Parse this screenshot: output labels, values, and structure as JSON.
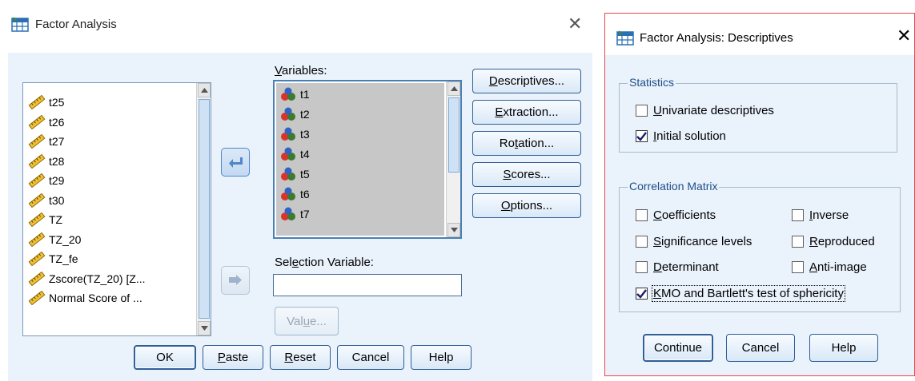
{
  "main_dialog": {
    "title": "Factor Analysis",
    "source_list": [
      "t25",
      "t26",
      "t27",
      "t28",
      "t29",
      "t30",
      "TZ",
      "TZ_20",
      "TZ_fe",
      "Zscore(TZ_20) [Z...",
      "Normal Score of ..."
    ],
    "variables_label": "Variables:",
    "variables_list": [
      "t1",
      "t2",
      "t3",
      "t4",
      "t5",
      "t6",
      "t7"
    ],
    "selection_variable_label": "Selection Variable:",
    "selection_variable_value": "",
    "value_button": "Value...",
    "side_buttons": {
      "descriptives": "Descriptives...",
      "extraction": "Extraction...",
      "rotation": "Rotation...",
      "scores": "Scores...",
      "options": "Options..."
    },
    "bottom_buttons": {
      "ok": "OK",
      "paste": "Paste",
      "reset": "Reset",
      "cancel": "Cancel",
      "help": "Help"
    }
  },
  "descriptives_dialog": {
    "title": "Factor Analysis: Descriptives",
    "statistics_group": "Statistics",
    "univariate": {
      "label": "Univariate descriptives",
      "checked": false
    },
    "initial_solution": {
      "label": "Initial solution",
      "checked": true
    },
    "correlation_group": "Correlation Matrix",
    "coefficients": {
      "label": "Coefficients",
      "checked": false
    },
    "significance": {
      "label": "Significance levels",
      "checked": false
    },
    "determinant": {
      "label": "Determinant",
      "checked": false
    },
    "inverse": {
      "label": "Inverse",
      "checked": false
    },
    "reproduced": {
      "label": "Reproduced",
      "checked": false
    },
    "anti_image": {
      "label": "Anti-image",
      "checked": false
    },
    "kmo": {
      "label": "KMO and Bartlett's test of sphericity",
      "checked": true
    },
    "buttons": {
      "continue": "Continue",
      "cancel": "Cancel",
      "help": "Help"
    }
  },
  "icons": {
    "app_icon": "spss-table-icon",
    "scale_variable_icon": "ruler-pencil-icon",
    "nominal_variable_icon": "three-balls-icon",
    "move_left_arrow": "arrow-left-icon",
    "move_right_arrow": "arrow-right-icon",
    "close": "close-icon"
  },
  "colors": {
    "dialog_bg": "#eaf2fb",
    "button_border": "#2f5f97",
    "arrow_active": "#4f87c9",
    "arrow_disabled": "#9fb4cc",
    "selection_gray": "#c7c7c7",
    "active_window_border": "#e8474c"
  }
}
